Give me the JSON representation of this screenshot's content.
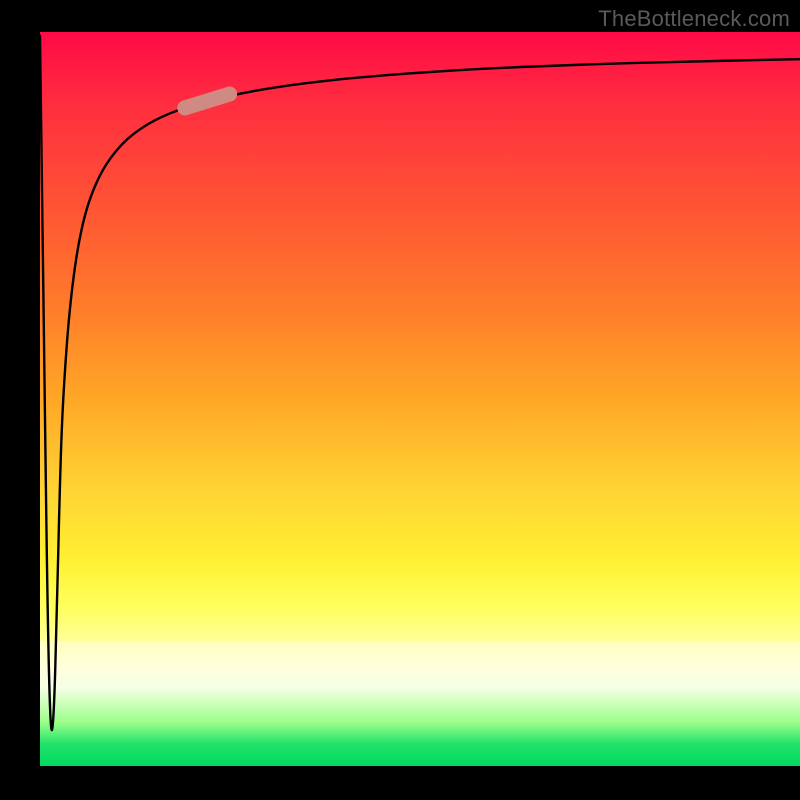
{
  "watermark": "TheBottleneck.com",
  "chart_data": {
    "type": "line",
    "title": "",
    "xlabel": "",
    "ylabel": "",
    "xlim": [
      0,
      1
    ],
    "ylim": [
      0,
      1
    ],
    "grid": false,
    "notes": "Axes unlabeled. Gradient background from red (top) through orange/yellow to green (bottom). Single curve: steep spike down near x≈0 then asymptotic rise toward y≈0.96. Pale rounded marker on curve near x≈0.22.",
    "series": [
      {
        "name": "curve",
        "x": [
          0.0,
          0.005,
          0.01,
          0.014,
          0.018,
          0.022,
          0.026,
          0.03,
          0.04,
          0.055,
          0.075,
          0.1,
          0.13,
          0.17,
          0.22,
          0.28,
          0.36,
          0.46,
          0.58,
          0.72,
          0.86,
          1.0
        ],
        "y": [
          0.995,
          0.6,
          0.2,
          0.04,
          0.06,
          0.2,
          0.38,
          0.5,
          0.64,
          0.74,
          0.8,
          0.84,
          0.868,
          0.89,
          0.906,
          0.92,
          0.932,
          0.942,
          0.95,
          0.956,
          0.96,
          0.963
        ]
      }
    ],
    "marker": {
      "x": 0.22,
      "y": 0.906,
      "color": "#cf8a84"
    },
    "colors": {
      "gradient_top": "#ff0a47",
      "gradient_mid": "#ffd233",
      "gradient_bottom": "#00d85f",
      "curve": "#000000",
      "marker": "#cf8a84"
    },
    "highlight_band_y": [
      0.12,
      0.18
    ]
  }
}
